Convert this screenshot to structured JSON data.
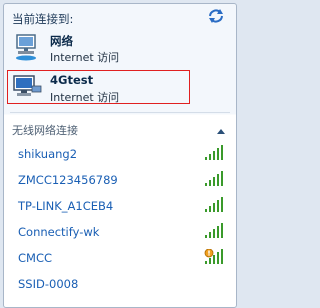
{
  "header": {
    "title": "当前连接到:",
    "refresh_icon": "refresh-icon"
  },
  "connected": [
    {
      "name": "网络",
      "status": "Internet 访问",
      "icon": "network-icon"
    },
    {
      "name": "4Gtest",
      "status": "Internet 访问",
      "icon": "computer-network-icon"
    }
  ],
  "wireless_section": {
    "title": "无线网络连接",
    "networks": [
      {
        "ssid": "shikuang2",
        "signal": 1.0
      },
      {
        "ssid": "ZMCC123456789",
        "signal": 1.0
      },
      {
        "ssid": "TP-LINK_A1CEB4",
        "signal": 1.0
      },
      {
        "ssid": "Connectify-wk",
        "signal": 1.0
      },
      {
        "ssid": "CMCC",
        "signal": 1.0,
        "secured_warning": true
      },
      {
        "ssid": "SSID-0008",
        "signal": null
      }
    ]
  },
  "colors": {
    "link_blue": "#1a5fb4",
    "signal_green": "#3a9a2b",
    "highlight_red": "#e02020"
  }
}
